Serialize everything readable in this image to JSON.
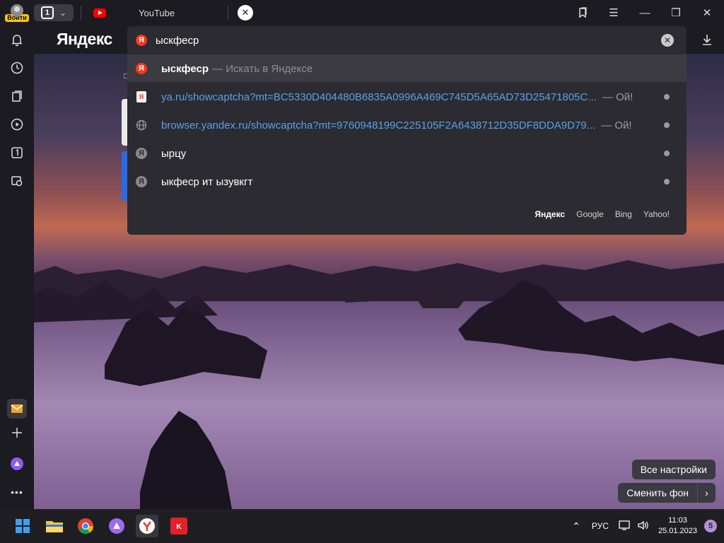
{
  "profile": {
    "login_label": "Войти"
  },
  "tabs": {
    "group_count": "1",
    "active_title": "YouTube"
  },
  "brand": {
    "name": "Яндекс"
  },
  "omnibox": {
    "value": "ыскфеср"
  },
  "suggestions": [
    {
      "type": "search",
      "text": "ыскфеср",
      "hint": "— Искать в Яндексе"
    },
    {
      "type": "url",
      "text": "ya.ru/showcaptcha?mt=BC5330D404480B6835A0996A469C745D5A65AD73D25471805C...",
      "suffix": "— Ой!"
    },
    {
      "type": "url",
      "text": "browser.yandex.ru/showcaptcha?mt=9760948199C225105F2A6438712D35DF8DDA9D79...",
      "suffix": "— Ой!"
    },
    {
      "type": "history",
      "text": "ырцу"
    },
    {
      "type": "history",
      "text": "ыкфеср ит ызувкгт"
    }
  ],
  "engines": [
    "Яндекс",
    "Google",
    "Bing",
    "Yahoo!"
  ],
  "buttons": {
    "all_settings": "Все настройки",
    "change_bg": "Сменить фон"
  },
  "taskbar": {
    "language": "РУС",
    "time": "11:03",
    "date": "25.01.2023",
    "notifications": "5"
  }
}
